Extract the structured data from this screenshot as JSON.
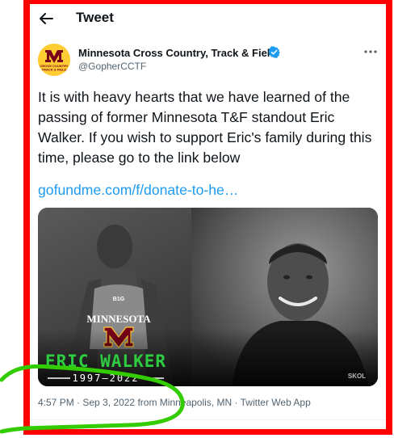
{
  "header": {
    "title": "Tweet",
    "back_icon": "arrow-left-icon"
  },
  "author": {
    "name": "Minnesota Cross Country, Track & Field",
    "handle": "@GopherCCTF",
    "avatar_icon": "minnesota-m-logo",
    "verified_icon": "verified-badge-icon",
    "more_icon": "more-horizontal-icon",
    "avatar_lettering": [
      "CROSS COUNTRY",
      "TRACK & FIELD"
    ]
  },
  "tweet": {
    "text": "It is with heavy hearts that we have learned of the passing of former Minnesota T&F standout Eric Walker. If you wish to support Eric's family during this time, please go to the link below",
    "link": "gofundme.com/f/donate-to-he…"
  },
  "media": {
    "name": "ERIC WALKER",
    "years": "1997—2022",
    "jersey_text": "MINNESOTA",
    "jersey_badge": "B1G",
    "watermark": "SKOL"
  },
  "meta": {
    "time": "4:57 PM",
    "separator": " · ",
    "date": "Sep 3, 2022",
    "location": " from Minneapolis, MN",
    "app": "Twitter Web App"
  },
  "colors": {
    "annotation_red": "#ff0000",
    "annotation_green": "#33cc00",
    "link_blue": "#1d9bf0",
    "verified_blue": "#1d9bf0",
    "avatar_gold": "#ffcc33",
    "avatar_maroon": "#7a0019",
    "name_green": "#2ecc40"
  }
}
